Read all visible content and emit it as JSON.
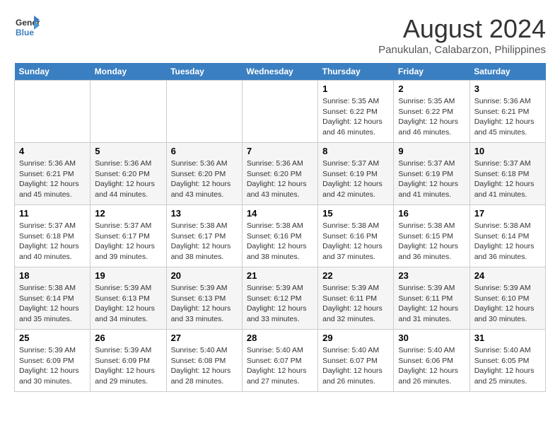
{
  "header": {
    "logo_line1": "General",
    "logo_line2": "Blue",
    "main_title": "August 2024",
    "subtitle": "Panukulan, Calabarzon, Philippines"
  },
  "days_of_week": [
    "Sunday",
    "Monday",
    "Tuesday",
    "Wednesday",
    "Thursday",
    "Friday",
    "Saturday"
  ],
  "weeks": [
    [
      {
        "num": "",
        "info": ""
      },
      {
        "num": "",
        "info": ""
      },
      {
        "num": "",
        "info": ""
      },
      {
        "num": "",
        "info": ""
      },
      {
        "num": "1",
        "info": "Sunrise: 5:35 AM\nSunset: 6:22 PM\nDaylight: 12 hours\nand 46 minutes."
      },
      {
        "num": "2",
        "info": "Sunrise: 5:35 AM\nSunset: 6:22 PM\nDaylight: 12 hours\nand 46 minutes."
      },
      {
        "num": "3",
        "info": "Sunrise: 5:36 AM\nSunset: 6:21 PM\nDaylight: 12 hours\nand 45 minutes."
      }
    ],
    [
      {
        "num": "4",
        "info": "Sunrise: 5:36 AM\nSunset: 6:21 PM\nDaylight: 12 hours\nand 45 minutes."
      },
      {
        "num": "5",
        "info": "Sunrise: 5:36 AM\nSunset: 6:20 PM\nDaylight: 12 hours\nand 44 minutes."
      },
      {
        "num": "6",
        "info": "Sunrise: 5:36 AM\nSunset: 6:20 PM\nDaylight: 12 hours\nand 43 minutes."
      },
      {
        "num": "7",
        "info": "Sunrise: 5:36 AM\nSunset: 6:20 PM\nDaylight: 12 hours\nand 43 minutes."
      },
      {
        "num": "8",
        "info": "Sunrise: 5:37 AM\nSunset: 6:19 PM\nDaylight: 12 hours\nand 42 minutes."
      },
      {
        "num": "9",
        "info": "Sunrise: 5:37 AM\nSunset: 6:19 PM\nDaylight: 12 hours\nand 41 minutes."
      },
      {
        "num": "10",
        "info": "Sunrise: 5:37 AM\nSunset: 6:18 PM\nDaylight: 12 hours\nand 41 minutes."
      }
    ],
    [
      {
        "num": "11",
        "info": "Sunrise: 5:37 AM\nSunset: 6:18 PM\nDaylight: 12 hours\nand 40 minutes."
      },
      {
        "num": "12",
        "info": "Sunrise: 5:37 AM\nSunset: 6:17 PM\nDaylight: 12 hours\nand 39 minutes."
      },
      {
        "num": "13",
        "info": "Sunrise: 5:38 AM\nSunset: 6:17 PM\nDaylight: 12 hours\nand 38 minutes."
      },
      {
        "num": "14",
        "info": "Sunrise: 5:38 AM\nSunset: 6:16 PM\nDaylight: 12 hours\nand 38 minutes."
      },
      {
        "num": "15",
        "info": "Sunrise: 5:38 AM\nSunset: 6:16 PM\nDaylight: 12 hours\nand 37 minutes."
      },
      {
        "num": "16",
        "info": "Sunrise: 5:38 AM\nSunset: 6:15 PM\nDaylight: 12 hours\nand 36 minutes."
      },
      {
        "num": "17",
        "info": "Sunrise: 5:38 AM\nSunset: 6:14 PM\nDaylight: 12 hours\nand 36 minutes."
      }
    ],
    [
      {
        "num": "18",
        "info": "Sunrise: 5:38 AM\nSunset: 6:14 PM\nDaylight: 12 hours\nand 35 minutes."
      },
      {
        "num": "19",
        "info": "Sunrise: 5:39 AM\nSunset: 6:13 PM\nDaylight: 12 hours\nand 34 minutes."
      },
      {
        "num": "20",
        "info": "Sunrise: 5:39 AM\nSunset: 6:13 PM\nDaylight: 12 hours\nand 33 minutes."
      },
      {
        "num": "21",
        "info": "Sunrise: 5:39 AM\nSunset: 6:12 PM\nDaylight: 12 hours\nand 33 minutes."
      },
      {
        "num": "22",
        "info": "Sunrise: 5:39 AM\nSunset: 6:11 PM\nDaylight: 12 hours\nand 32 minutes."
      },
      {
        "num": "23",
        "info": "Sunrise: 5:39 AM\nSunset: 6:11 PM\nDaylight: 12 hours\nand 31 minutes."
      },
      {
        "num": "24",
        "info": "Sunrise: 5:39 AM\nSunset: 6:10 PM\nDaylight: 12 hours\nand 30 minutes."
      }
    ],
    [
      {
        "num": "25",
        "info": "Sunrise: 5:39 AM\nSunset: 6:09 PM\nDaylight: 12 hours\nand 30 minutes."
      },
      {
        "num": "26",
        "info": "Sunrise: 5:39 AM\nSunset: 6:09 PM\nDaylight: 12 hours\nand 29 minutes."
      },
      {
        "num": "27",
        "info": "Sunrise: 5:40 AM\nSunset: 6:08 PM\nDaylight: 12 hours\nand 28 minutes."
      },
      {
        "num": "28",
        "info": "Sunrise: 5:40 AM\nSunset: 6:07 PM\nDaylight: 12 hours\nand 27 minutes."
      },
      {
        "num": "29",
        "info": "Sunrise: 5:40 AM\nSunset: 6:07 PM\nDaylight: 12 hours\nand 26 minutes."
      },
      {
        "num": "30",
        "info": "Sunrise: 5:40 AM\nSunset: 6:06 PM\nDaylight: 12 hours\nand 26 minutes."
      },
      {
        "num": "31",
        "info": "Sunrise: 5:40 AM\nSunset: 6:05 PM\nDaylight: 12 hours\nand 25 minutes."
      }
    ]
  ]
}
